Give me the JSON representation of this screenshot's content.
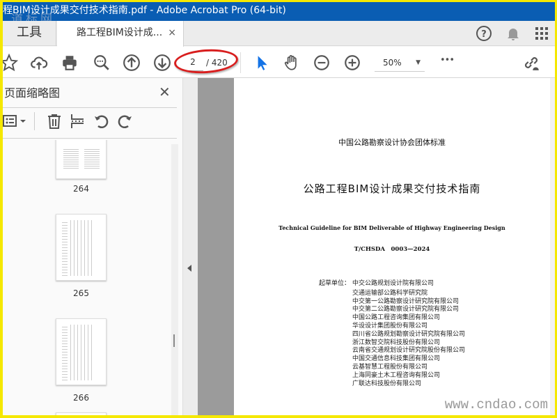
{
  "window": {
    "title": "程BIM设计成果交付技术指南.pdf - Adobe Acrobat Pro (64-bit)",
    "watermark_logo": "道标网"
  },
  "tabs": {
    "tools": "工具",
    "document": "路工程BIM设计成...",
    "close": "×"
  },
  "toolbar": {
    "current_page": "2",
    "total_pages": "/ 420",
    "zoom": "50%",
    "zoom_caret": "▼",
    "more": "•••",
    "icons": [
      "star-icon",
      "cloud-upload-icon",
      "print-icon",
      "zoom-out-search-icon",
      "page-up-icon",
      "page-down-icon",
      "select-cursor-icon",
      "hand-icon",
      "zoom-out-icon",
      "zoom-in-icon",
      "more-icon",
      "share-link-icon"
    ]
  },
  "topright_icons": [
    "help-icon",
    "bell-icon",
    "apps-grid-icon"
  ],
  "annotation_color": "#d81e1e",
  "left_panel": {
    "title": "页面缩略图",
    "close": "✕",
    "thumbnails": [
      {
        "label": "264"
      },
      {
        "label": "265"
      },
      {
        "label": "266"
      }
    ]
  },
  "document": {
    "org": "中国公路勘察设计协会团体标准",
    "title": "公路工程BIM设计成果交付技术指南",
    "title_en": "Technical Guideline for BIM Deliverable of Highway Engineering Design",
    "code": "T/CHSDA　0003—2024",
    "drafting_label": "起草单位：",
    "drafting_units": [
      "中交公路规划设计院有限公司",
      "交通运输部公路科学研究院",
      "中交第一公路勘察设计研究院有限公司",
      "中交第二公路勘察设计研究院有限公司",
      "中国公路工程咨询集团有限公司",
      "华设设计集团股份有限公司",
      "四川省公路规划勘察设计研究院有限公司",
      "浙江数智交院科技股份有限公司",
      "云南省交通规划设计研究院股份有限公司",
      "中国交通信息科技集团有限公司",
      "云基智慧工程股份有限公司",
      "上海同豪土木工程咨询有限公司",
      "广联达科技股份有限公司"
    ]
  },
  "watermark_site": "www.cndao.com"
}
